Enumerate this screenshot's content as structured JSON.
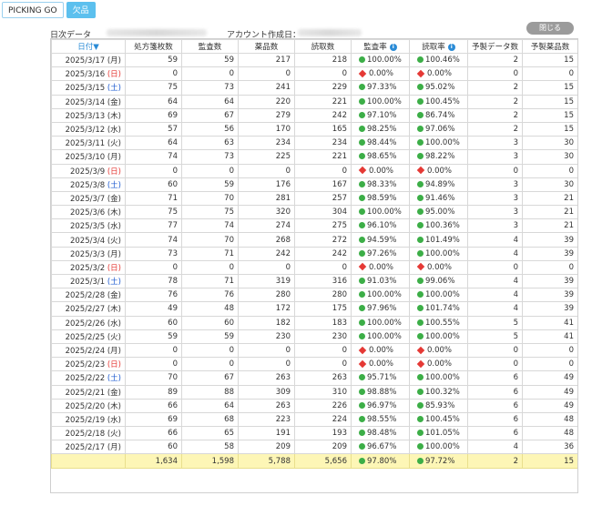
{
  "tabs": [
    {
      "label": "PICKING GO",
      "active": false
    },
    {
      "label": "欠品",
      "active": true
    }
  ],
  "info": {
    "daily_label": "日次データ",
    "account_label": "アカウント作成日："
  },
  "close_label": "閉じる",
  "columns": [
    "日付▼",
    "処方箋枚数",
    "監査数",
    "薬品数",
    "読取数",
    "監査率",
    "読取率",
    "予製データ数",
    "予製薬品数"
  ],
  "colors": {
    "ok": "#3cae47",
    "ng": "#e53935",
    "saturday": "#1e5bd0",
    "sunday": "#e53935",
    "total_bg": "#fdf6b6",
    "tab_active": "#5cc0ee"
  },
  "rows": [
    {
      "date": "2025/3/17",
      "dow": "(月)",
      "w": "",
      "c1": "59",
      "c2": "59",
      "c3": "217",
      "c4": "218",
      "r1": "100.00%",
      "r1s": "ok",
      "r2": "100.46%",
      "r2s": "ok",
      "c5": "2",
      "c6": "15"
    },
    {
      "date": "2025/3/16",
      "dow": "(日)",
      "w": "sun",
      "c1": "0",
      "c2": "0",
      "c3": "0",
      "c4": "0",
      "r1": "0.00%",
      "r1s": "ng",
      "r2": "0.00%",
      "r2s": "ng",
      "c5": "0",
      "c6": "0"
    },
    {
      "date": "2025/3/15",
      "dow": "(土)",
      "w": "sat",
      "c1": "75",
      "c2": "73",
      "c3": "241",
      "c4": "229",
      "r1": "97.33%",
      "r1s": "ok",
      "r2": "95.02%",
      "r2s": "ok",
      "c5": "2",
      "c6": "15"
    },
    {
      "date": "2025/3/14",
      "dow": "(金)",
      "w": "",
      "c1": "64",
      "c2": "64",
      "c3": "220",
      "c4": "221",
      "r1": "100.00%",
      "r1s": "ok",
      "r2": "100.45%",
      "r2s": "ok",
      "c5": "2",
      "c6": "15"
    },
    {
      "date": "2025/3/13",
      "dow": "(木)",
      "w": "",
      "c1": "69",
      "c2": "67",
      "c3": "279",
      "c4": "242",
      "r1": "97.10%",
      "r1s": "ok",
      "r2": "86.74%",
      "r2s": "ok",
      "c5": "2",
      "c6": "15"
    },
    {
      "date": "2025/3/12",
      "dow": "(水)",
      "w": "",
      "c1": "57",
      "c2": "56",
      "c3": "170",
      "c4": "165",
      "r1": "98.25%",
      "r1s": "ok",
      "r2": "97.06%",
      "r2s": "ok",
      "c5": "2",
      "c6": "15"
    },
    {
      "date": "2025/3/11",
      "dow": "(火)",
      "w": "",
      "c1": "64",
      "c2": "63",
      "c3": "234",
      "c4": "234",
      "r1": "98.44%",
      "r1s": "ok",
      "r2": "100.00%",
      "r2s": "ok",
      "c5": "3",
      "c6": "30"
    },
    {
      "date": "2025/3/10",
      "dow": "(月)",
      "w": "",
      "c1": "74",
      "c2": "73",
      "c3": "225",
      "c4": "221",
      "r1": "98.65%",
      "r1s": "ok",
      "r2": "98.22%",
      "r2s": "ok",
      "c5": "3",
      "c6": "30"
    },
    {
      "date": "2025/3/9",
      "dow": "(日)",
      "w": "sun",
      "c1": "0",
      "c2": "0",
      "c3": "0",
      "c4": "0",
      "r1": "0.00%",
      "r1s": "ng",
      "r2": "0.00%",
      "r2s": "ng",
      "c5": "0",
      "c6": "0"
    },
    {
      "date": "2025/3/8",
      "dow": "(土)",
      "w": "sat",
      "c1": "60",
      "c2": "59",
      "c3": "176",
      "c4": "167",
      "r1": "98.33%",
      "r1s": "ok",
      "r2": "94.89%",
      "r2s": "ok",
      "c5": "3",
      "c6": "30"
    },
    {
      "date": "2025/3/7",
      "dow": "(金)",
      "w": "",
      "c1": "71",
      "c2": "70",
      "c3": "281",
      "c4": "257",
      "r1": "98.59%",
      "r1s": "ok",
      "r2": "91.46%",
      "r2s": "ok",
      "c5": "3",
      "c6": "21"
    },
    {
      "date": "2025/3/6",
      "dow": "(木)",
      "w": "",
      "c1": "75",
      "c2": "75",
      "c3": "320",
      "c4": "304",
      "r1": "100.00%",
      "r1s": "ok",
      "r2": "95.00%",
      "r2s": "ok",
      "c5": "3",
      "c6": "21"
    },
    {
      "date": "2025/3/5",
      "dow": "(水)",
      "w": "",
      "c1": "77",
      "c2": "74",
      "c3": "274",
      "c4": "275",
      "r1": "96.10%",
      "r1s": "ok",
      "r2": "100.36%",
      "r2s": "ok",
      "c5": "3",
      "c6": "21"
    },
    {
      "date": "2025/3/4",
      "dow": "(火)",
      "w": "",
      "c1": "74",
      "c2": "70",
      "c3": "268",
      "c4": "272",
      "r1": "94.59%",
      "r1s": "ok",
      "r2": "101.49%",
      "r2s": "ok",
      "c5": "4",
      "c6": "39"
    },
    {
      "date": "2025/3/3",
      "dow": "(月)",
      "w": "",
      "c1": "73",
      "c2": "71",
      "c3": "242",
      "c4": "242",
      "r1": "97.26%",
      "r1s": "ok",
      "r2": "100.00%",
      "r2s": "ok",
      "c5": "4",
      "c6": "39"
    },
    {
      "date": "2025/3/2",
      "dow": "(日)",
      "w": "sun",
      "c1": "0",
      "c2": "0",
      "c3": "0",
      "c4": "0",
      "r1": "0.00%",
      "r1s": "ng",
      "r2": "0.00%",
      "r2s": "ng",
      "c5": "0",
      "c6": "0"
    },
    {
      "date": "2025/3/1",
      "dow": "(土)",
      "w": "sat",
      "c1": "78",
      "c2": "71",
      "c3": "319",
      "c4": "316",
      "r1": "91.03%",
      "r1s": "ok",
      "r2": "99.06%",
      "r2s": "ok",
      "c5": "4",
      "c6": "39"
    },
    {
      "date": "2025/2/28",
      "dow": "(金)",
      "w": "",
      "c1": "76",
      "c2": "76",
      "c3": "280",
      "c4": "280",
      "r1": "100.00%",
      "r1s": "ok",
      "r2": "100.00%",
      "r2s": "ok",
      "c5": "4",
      "c6": "39"
    },
    {
      "date": "2025/2/27",
      "dow": "(木)",
      "w": "",
      "c1": "49",
      "c2": "48",
      "c3": "172",
      "c4": "175",
      "r1": "97.96%",
      "r1s": "ok",
      "r2": "101.74%",
      "r2s": "ok",
      "c5": "4",
      "c6": "39"
    },
    {
      "date": "2025/2/26",
      "dow": "(水)",
      "w": "",
      "c1": "60",
      "c2": "60",
      "c3": "182",
      "c4": "183",
      "r1": "100.00%",
      "r1s": "ok",
      "r2": "100.55%",
      "r2s": "ok",
      "c5": "5",
      "c6": "41"
    },
    {
      "date": "2025/2/25",
      "dow": "(火)",
      "w": "",
      "c1": "59",
      "c2": "59",
      "c3": "230",
      "c4": "230",
      "r1": "100.00%",
      "r1s": "ok",
      "r2": "100.00%",
      "r2s": "ok",
      "c5": "5",
      "c6": "41"
    },
    {
      "date": "2025/2/24",
      "dow": "(月)",
      "w": "",
      "c1": "0",
      "c2": "0",
      "c3": "0",
      "c4": "0",
      "r1": "0.00%",
      "r1s": "ng",
      "r2": "0.00%",
      "r2s": "ng",
      "c5": "0",
      "c6": "0"
    },
    {
      "date": "2025/2/23",
      "dow": "(日)",
      "w": "sun",
      "c1": "0",
      "c2": "0",
      "c3": "0",
      "c4": "0",
      "r1": "0.00%",
      "r1s": "ng",
      "r2": "0.00%",
      "r2s": "ng",
      "c5": "0",
      "c6": "0"
    },
    {
      "date": "2025/2/22",
      "dow": "(土)",
      "w": "sat",
      "c1": "70",
      "c2": "67",
      "c3": "263",
      "c4": "263",
      "r1": "95.71%",
      "r1s": "ok",
      "r2": "100.00%",
      "r2s": "ok",
      "c5": "6",
      "c6": "49"
    },
    {
      "date": "2025/2/21",
      "dow": "(金)",
      "w": "",
      "c1": "89",
      "c2": "88",
      "c3": "309",
      "c4": "310",
      "r1": "98.88%",
      "r1s": "ok",
      "r2": "100.32%",
      "r2s": "ok",
      "c5": "6",
      "c6": "49"
    },
    {
      "date": "2025/2/20",
      "dow": "(木)",
      "w": "",
      "c1": "66",
      "c2": "64",
      "c3": "263",
      "c4": "226",
      "r1": "96.97%",
      "r1s": "ok",
      "r2": "85.93%",
      "r2s": "ok",
      "c5": "6",
      "c6": "49"
    },
    {
      "date": "2025/2/19",
      "dow": "(水)",
      "w": "",
      "c1": "69",
      "c2": "68",
      "c3": "223",
      "c4": "224",
      "r1": "98.55%",
      "r1s": "ok",
      "r2": "100.45%",
      "r2s": "ok",
      "c5": "6",
      "c6": "48"
    },
    {
      "date": "2025/2/18",
      "dow": "(火)",
      "w": "",
      "c1": "66",
      "c2": "65",
      "c3": "191",
      "c4": "193",
      "r1": "98.48%",
      "r1s": "ok",
      "r2": "101.05%",
      "r2s": "ok",
      "c5": "6",
      "c6": "48"
    },
    {
      "date": "2025/2/17",
      "dow": "(月)",
      "w": "",
      "c1": "60",
      "c2": "58",
      "c3": "209",
      "c4": "209",
      "r1": "96.67%",
      "r1s": "ok",
      "r2": "100.00%",
      "r2s": "ok",
      "c5": "4",
      "c6": "36"
    }
  ],
  "totals": {
    "c1": "1,634",
    "c2": "1,598",
    "c3": "5,788",
    "c4": "5,656",
    "r1": "97.80%",
    "r1s": "ok",
    "r2": "97.72%",
    "r2s": "ok",
    "c5": "2",
    "c6": "15"
  }
}
